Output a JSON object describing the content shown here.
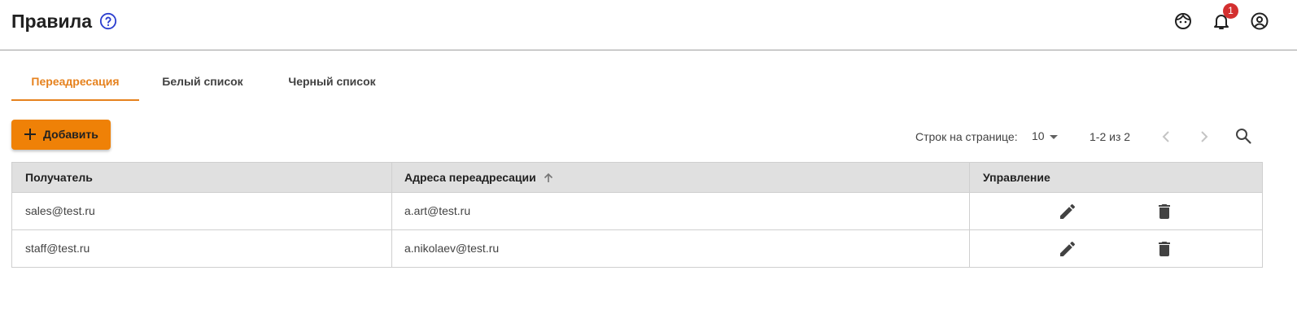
{
  "header": {
    "title": "Правила",
    "notification_count": "1",
    "icons": [
      "help-icon",
      "support-face-icon",
      "bell-icon",
      "account-circle-icon"
    ]
  },
  "tabs": [
    {
      "label": "Переадресация",
      "active": true
    },
    {
      "label": "Белый список",
      "active": false
    },
    {
      "label": "Черный список",
      "active": false
    }
  ],
  "toolbar": {
    "add_label": "Добавить"
  },
  "pagination": {
    "rows_label": "Строк на странице:",
    "rows_value": "10",
    "range": "1-2 из 2"
  },
  "table": {
    "columns": [
      "Получатель",
      "Адреса переадресации",
      "Управление"
    ],
    "sorted_column": "Адреса переадресации",
    "sort_direction": "asc",
    "rows": [
      {
        "recipient": "sales@test.ru",
        "forward": "a.art@test.ru"
      },
      {
        "recipient": "staff@test.ru",
        "forward": "a.nikolaev@test.ru"
      }
    ]
  },
  "colors": {
    "accent": "#e6821e",
    "button": "#ef8107",
    "badge": "#d32f2f",
    "header_bg": "#e0e0e0"
  }
}
